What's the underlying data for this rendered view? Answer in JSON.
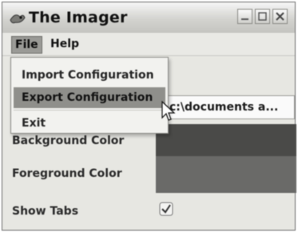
{
  "window": {
    "title": "The Imager",
    "app_icon": "imager-logo-icon",
    "controls": [
      "minimize-icon",
      "maximize-icon",
      "close-icon"
    ]
  },
  "menubar": {
    "items": [
      {
        "label": "File"
      },
      {
        "label": "Help"
      }
    ]
  },
  "file_menu": {
    "items": [
      {
        "label": "Import Configuration"
      },
      {
        "label": "Export Configuration"
      },
      {
        "label": "Exit"
      }
    ]
  },
  "form": {
    "path_value": "c:\\documents a...",
    "background_label": "Background Color",
    "foreground_label": "Foreground Color",
    "show_tabs_label": "Show Tabs",
    "show_tabs_checked": true,
    "background_color": "#4a4a48",
    "foreground_color": "#6a6a68"
  },
  "colors": {
    "window_bg": "#e7e7e2",
    "selection": "#8f8f8b"
  }
}
